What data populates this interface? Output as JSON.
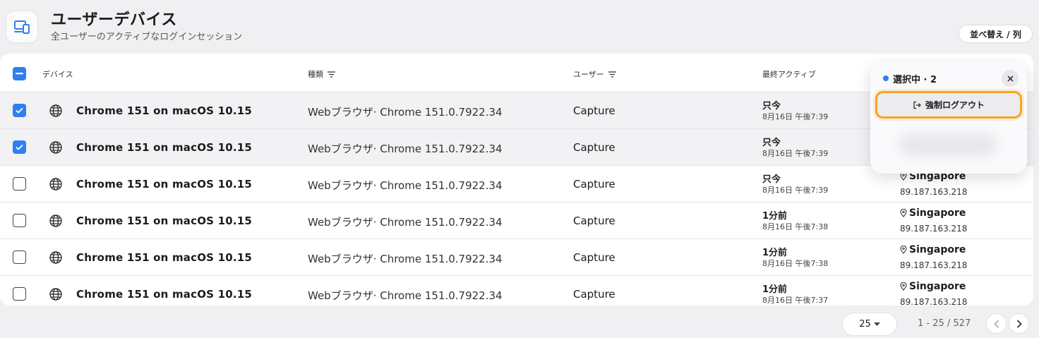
{
  "header": {
    "title": "ユーザーデバイス",
    "subtitle": "全ユーザーのアクティブなログインセッション",
    "sort_button": "並べ替え / 列",
    "app_icon": "devices-icon"
  },
  "table": {
    "columns": {
      "device": "デバイス",
      "kind": "種類",
      "user": "ユーザー",
      "last_active": "最終アクティブ"
    },
    "rows": [
      {
        "selected": true,
        "device": "Chrome 151 on macOS 10.15",
        "kind": "Webブラウザ· Chrome 151.0.7922.34",
        "user": "Capture",
        "active_rel": "只今",
        "active_abs": "8月16日 午後7:39",
        "city": "",
        "ip": ""
      },
      {
        "selected": true,
        "device": "Chrome 151 on macOS 10.15",
        "kind": "Webブラウザ· Chrome 151.0.7922.34",
        "user": "Capture",
        "active_rel": "只今",
        "active_abs": "8月16日 午後7:39",
        "city": "",
        "ip": ""
      },
      {
        "selected": false,
        "device": "Chrome 151 on macOS 10.15",
        "kind": "Webブラウザ· Chrome 151.0.7922.34",
        "user": "Capture",
        "active_rel": "只今",
        "active_abs": "8月16日 午後7:39",
        "city": "Singapore",
        "ip": "89.187.163.218"
      },
      {
        "selected": false,
        "device": "Chrome 151 on macOS 10.15",
        "kind": "Webブラウザ· Chrome 151.0.7922.34",
        "user": "Capture",
        "active_rel": "1分前",
        "active_abs": "8月16日 午後7:38",
        "city": "Singapore",
        "ip": "89.187.163.218"
      },
      {
        "selected": false,
        "device": "Chrome 151 on macOS 10.15",
        "kind": "Webブラウザ· Chrome 151.0.7922.34",
        "user": "Capture",
        "active_rel": "1分前",
        "active_abs": "8月16日 午後7:38",
        "city": "Singapore",
        "ip": "89.187.163.218"
      },
      {
        "selected": false,
        "device": "Chrome 151 on macOS 10.15",
        "kind": "Webブラウザ· Chrome 151.0.7922.34",
        "user": "Capture",
        "active_rel": "1分前",
        "active_abs": "8月16日 午後7:37",
        "city": "Singapore",
        "ip": "89.187.163.218"
      }
    ]
  },
  "popover": {
    "selection_label": "選択中 · 2",
    "action_label": "強制ログアウト"
  },
  "pagination": {
    "page_size": "25",
    "range": "1 - 25 / 527"
  },
  "colors": {
    "accent": "#2f7ff0",
    "highlight": "#f5a524"
  }
}
